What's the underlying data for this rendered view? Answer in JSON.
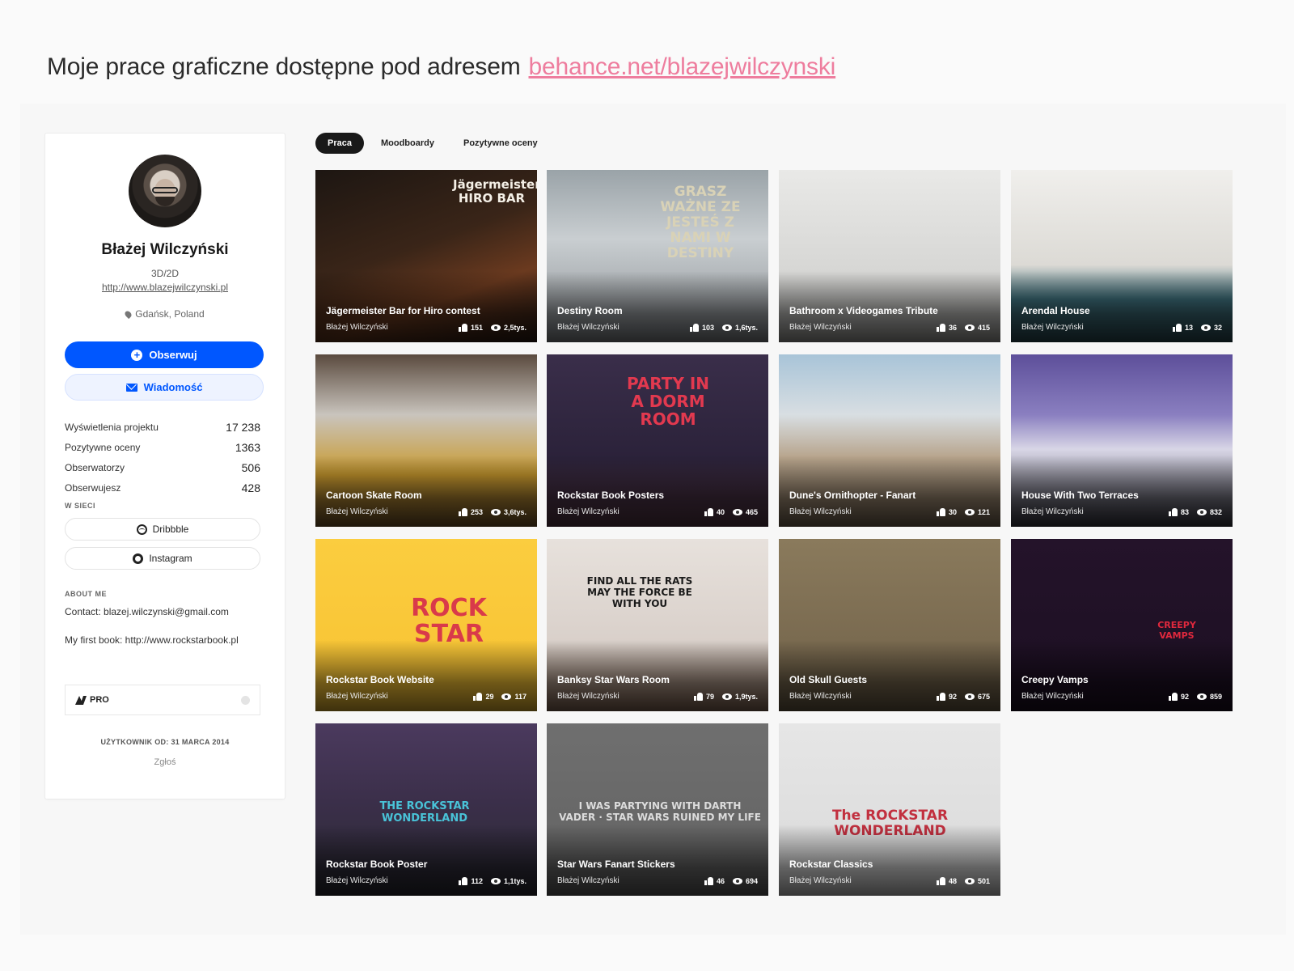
{
  "heading": {
    "text": "Moje prace graficzne dostępne pod adresem",
    "link": "behance.net/blazejwilczynski"
  },
  "profile": {
    "name": "Błażej Wilczyński",
    "role": "3D/2D",
    "website": "http://www.blazejwilczynski.pl",
    "location": "Gdańsk, Poland",
    "follow_label": "Obserwuj",
    "message_label": "Wiadomość",
    "stats": [
      {
        "label": "Wyświetlenia projektu",
        "value": "17 238"
      },
      {
        "label": "Pozytywne oceny",
        "value": "1363"
      },
      {
        "label": "Obserwatorzy",
        "value": "506"
      },
      {
        "label": "Obserwujesz",
        "value": "428"
      }
    ],
    "social_heading": "W SIECI",
    "social": [
      {
        "label": "Dribbble",
        "icon": "dribbble-icon"
      },
      {
        "label": "Instagram",
        "icon": "instagram-icon"
      }
    ],
    "about_heading": "ABOUT ME",
    "about_contact": "Contact: blazej.wilczynski@gmail.com",
    "about_book": "My first book: http://www.rockstarbook.pl",
    "pro_label": "PRO",
    "member_since": "UŻYTKOWNIK OD: 31 MARCA 2014",
    "report": "Zgłoś"
  },
  "tabs": [
    "Praca",
    "Moodboardy",
    "Pozytywne oceny"
  ],
  "projects": [
    {
      "title": "Jägermeister Bar for Hiro contest",
      "owner": "Błażej Wilczyński",
      "likes": "151",
      "views": "2,5tys.",
      "art": {
        "bg": "linear-gradient(160deg,#1d1612 0%,#3a2518 45%,#6b3a1f 70%,#2a1a12 100%)",
        "text": "Jägermeister HIRO BAR",
        "color": "#f4efe6"
      }
    },
    {
      "title": "Destiny Room",
      "owner": "Błażej Wilczyński",
      "likes": "103",
      "views": "1,6tys.",
      "art": {
        "bg": "linear-gradient(180deg,#9aa3a8 0%,#c9ced1 40%,#8a8f93 100%)",
        "text": "GRASZ WAŻNE ZE JESTEŚ Z NAMI W DESTINY",
        "color": "#d9d2b6"
      }
    },
    {
      "title": "Bathroom x Videogames Tribute",
      "owner": "Błażej Wilczyński",
      "likes": "36",
      "views": "415",
      "art": {
        "bg": "linear-gradient(180deg,#e9e9e7 0%,#d6d6d4 60%,#a9a9a6 100%)",
        "text": "",
        "color": "#c33"
      }
    },
    {
      "title": "Arendal House",
      "owner": "Błażej Wilczyński",
      "likes": "13",
      "views": "32",
      "art": {
        "bg": "linear-gradient(180deg,#f0efec 0%,#dcdad5 55%,#3d6e7a 75%,#2c4f58 100%)",
        "text": "",
        "color": "#fff"
      }
    },
    {
      "title": "Cartoon Skate Room",
      "owner": "Błażej Wilczyński",
      "likes": "253",
      "views": "3,6tys.",
      "art": {
        "bg": "linear-gradient(180deg,#5a4a3e 0%,#c9c4bd 35%,#c99a2e 70%,#7a5a2c 100%)",
        "text": "",
        "color": "#333"
      }
    },
    {
      "title": "Rockstar Book Posters",
      "owner": "Błażej Wilczyński",
      "likes": "40",
      "views": "465",
      "art": {
        "bg": "linear-gradient(180deg,#3a2e4a 0%,#2b223a 60%,#5a3a4a 100%)",
        "text": "PARTY IN A DORM ROOM",
        "color": "#e2394f"
      }
    },
    {
      "title": "Dune's Ornithopter - Fanart",
      "owner": "Błażej Wilczyński",
      "likes": "30",
      "views": "121",
      "art": {
        "bg": "linear-gradient(180deg,#a8c4d8 0%,#d8dee2 35%,#b7a48c 60%,#7d6b56 100%)",
        "text": "",
        "color": "#333"
      }
    },
    {
      "title": "House With Two Terraces",
      "owner": "Błażej Wilczyński",
      "likes": "83",
      "views": "832",
      "art": {
        "bg": "linear-gradient(180deg,#5d4f9a 0%,#8a7fc0 35%,#d8d6e6 55%,#3a3a44 100%)",
        "text": "",
        "color": "#fff"
      }
    },
    {
      "title": "Rockstar Book Website",
      "owner": "Błażej Wilczyński",
      "likes": "29",
      "views": "117",
      "art": {
        "bg": "linear-gradient(180deg,#fbcd3f 0%,#f7c232 100%)",
        "text": "ROCK STAR",
        "color": "#d93a4a"
      }
    },
    {
      "title": "Banksy Star Wars Room",
      "owner": "Błażej Wilczyński",
      "likes": "79",
      "views": "1,9tys.",
      "art": {
        "bg": "linear-gradient(180deg,#e7e1dc 0%,#d9d0ca 60%,#8e6f5a 100%)",
        "text": "FIND ALL THE RATS MAY THE FORCE BE WITH YOU",
        "color": "#1a1a1a"
      }
    },
    {
      "title": "Old Skull Guests",
      "owner": "Błażej Wilczyński",
      "likes": "92",
      "views": "675",
      "art": {
        "bg": "linear-gradient(180deg,#8a7a5c 0%,#6f6048 100%)",
        "text": "",
        "color": "#fff"
      }
    },
    {
      "title": "Creepy Vamps",
      "owner": "Błażej Wilczyński",
      "likes": "92",
      "views": "859",
      "art": {
        "bg": "linear-gradient(180deg,#24132a 0%,#1c0f22 100%)",
        "text": "CREEPY VAMPS",
        "color": "#e0283d"
      }
    },
    {
      "title": "Rockstar Book Poster",
      "owner": "Błażej Wilczyński",
      "likes": "112",
      "views": "1,1tys.",
      "art": {
        "bg": "linear-gradient(180deg,#4b3a5e 0%,#3b2f4a 45%,#2a2a33 100%)",
        "text": "THE ROCKSTAR WONDERLAND",
        "color": "#49c3d8"
      }
    },
    {
      "title": "Star Wars Fanart Stickers",
      "owner": "Błażej Wilczyński",
      "likes": "46",
      "views": "694",
      "art": {
        "bg": "linear-gradient(180deg,#6f6f6f 0%,#626262 100%)",
        "text": "I WAS PARTYING WITH DARTH VADER · STAR WARS RUINED MY LIFE",
        "color": "#dcdcdc"
      }
    },
    {
      "title": "Rockstar Classics",
      "owner": "Błażej Wilczyński",
      "likes": "48",
      "views": "501",
      "art": {
        "bg": "linear-gradient(180deg,#e6e6e6 0%,#d9d9d9 100%)",
        "text": "The ROCKSTAR WONDERLAND",
        "color": "#c2303f"
      }
    }
  ],
  "colors": {
    "accent": "#0057ff",
    "link_pink": "#ee7d9e",
    "tab_active": "#191919"
  }
}
